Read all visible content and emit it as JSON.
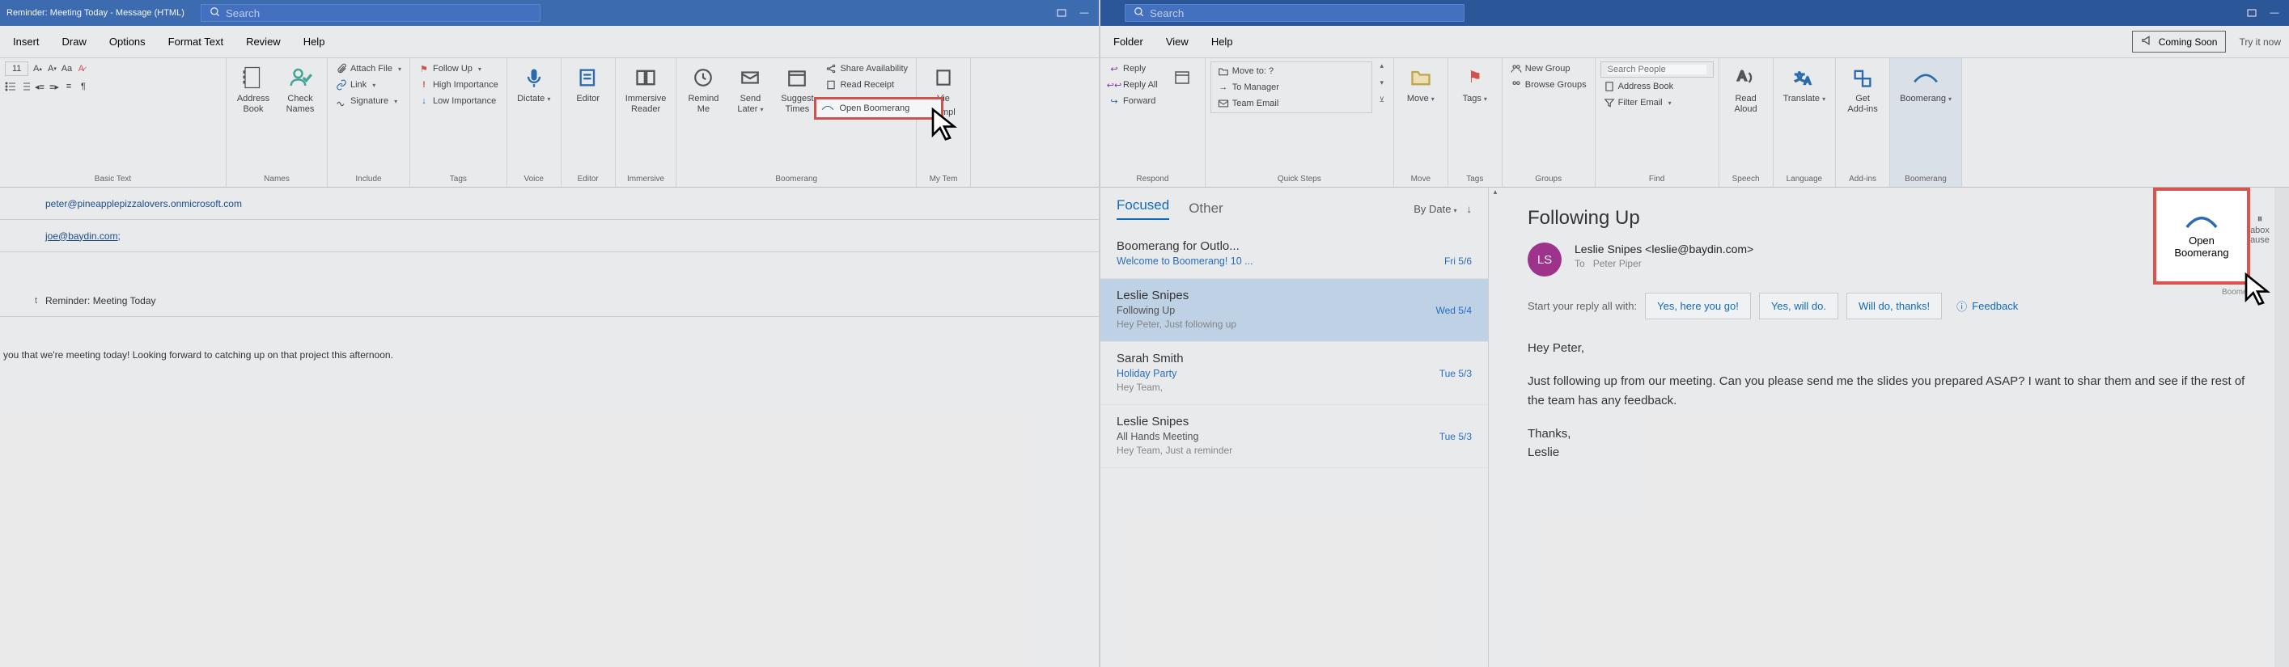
{
  "left": {
    "title": "Reminder: Meeting Today - Message (HTML)",
    "search_placeholder": "Search",
    "menu": [
      "Insert",
      "Draw",
      "Options",
      "Format Text",
      "Review",
      "Help"
    ],
    "font_size": "11",
    "ribbon_groups": {
      "basic_text": "Basic Text",
      "names": {
        "label": "Names",
        "address_book": "Address\nBook",
        "check_names": "Check\nNames"
      },
      "include": {
        "label": "Include",
        "attach_file": "Attach File",
        "link": "Link",
        "signature": "Signature"
      },
      "tags": {
        "label": "Tags",
        "follow_up": "Follow Up",
        "high": "High Importance",
        "low": "Low Importance"
      },
      "voice": {
        "label": "Voice",
        "dictate": "Dictate"
      },
      "editor": {
        "label": "Editor",
        "editor": "Editor"
      },
      "immersive": {
        "label": "Immersive",
        "reader": "Immersive\nReader"
      },
      "boomerang": {
        "label": "Boomerang",
        "remind": "Remind\nMe",
        "send_later": "Send\nLater",
        "suggest": "Suggest\nTimes",
        "open_boomerang": "Open Boomerang",
        "share_avail": "Share Availability",
        "read_receipt": "Read Receipt"
      },
      "templates": {
        "label": "My Tem",
        "view": "Vie",
        "templ": "Templ"
      }
    },
    "compose": {
      "to_value": "peter@pineapplepizzalovers.onmicrosoft.com",
      "cc_value": "joe@baydin.com;",
      "subject_label": "t",
      "subject_value": "Reminder: Meeting Today",
      "body": "you that we're meeting today! Looking forward to catching up on that project this afternoon."
    }
  },
  "right": {
    "search_placeholder": "Search",
    "menu": [
      "Folder",
      "View",
      "Help"
    ],
    "coming_soon": "Coming Soon",
    "try_it": "Try it now",
    "ribbon": {
      "respond": {
        "label": "Respond",
        "reply": "Reply",
        "reply_all": "Reply All",
        "forward": "Forward"
      },
      "quick_steps": {
        "label": "Quick Steps",
        "move_to": "Move to: ?",
        "to_manager": "To Manager",
        "team_email": "Team Email"
      },
      "move": {
        "label": "Move",
        "btn": "Move"
      },
      "tags": {
        "label": "Tags",
        "btn": "Tags"
      },
      "groups": {
        "label": "Groups",
        "new_group": "New Group",
        "browse": "Browse Groups"
      },
      "find": {
        "label": "Find",
        "search_people_ph": "Search People",
        "address_book": "Address Book",
        "filter_email": "Filter Email"
      },
      "speech": {
        "label": "Speech",
        "read_aloud": "Read\nAloud"
      },
      "language": {
        "label": "Language",
        "translate": "Translate"
      },
      "addins": {
        "label": "Add-ins",
        "get": "Get\nAdd-ins"
      },
      "boomerang": {
        "label": "Boomerang",
        "btn": "Boomerang"
      }
    },
    "list": {
      "focused": "Focused",
      "other": "Other",
      "by_date": "By Date",
      "items": [
        {
          "sender": "Boomerang for Outlo...",
          "subject": "Welcome to Boomerang! 10 ...",
          "date": "Fri 5/6",
          "preview": "",
          "blue": true
        },
        {
          "sender": "Leslie Snipes",
          "subject": "Following Up",
          "date": "Wed 5/4",
          "preview": "Hey Peter,  Just following up",
          "selected": true
        },
        {
          "sender": "Sarah Smith",
          "subject": "Holiday Party",
          "date": "Tue 5/3",
          "preview": "Hey Team,",
          "blue": true
        },
        {
          "sender": "Leslie Snipes",
          "subject": "All Hands Meeting",
          "date": "Tue 5/3",
          "preview": "Hey Team,  Just a reminder"
        }
      ]
    },
    "reading": {
      "subject": "Following Up",
      "avatar_initials": "LS",
      "sender_display": "Leslie Snipes <leslie@baydin.com>",
      "to_label": "To",
      "to_value": "Peter Piper",
      "quick_label": "Start your reply all with:",
      "quick": [
        "Yes, here you go!",
        "Yes, will do.",
        "Will do, thanks!"
      ],
      "feedback": "Feedback",
      "body_greeting": "Hey Peter,",
      "body_main": "Just following up from our meeting. Can you please send me the slides you prepared ASAP? I want to shar them and see if the rest of the team has any feedback.",
      "body_sign1": "Thanks,",
      "body_sign2": "Leslie"
    },
    "popup": {
      "line1": "Open",
      "line2": "Boomerang",
      "under": "Boomer",
      "pause": "abox\nause"
    }
  }
}
